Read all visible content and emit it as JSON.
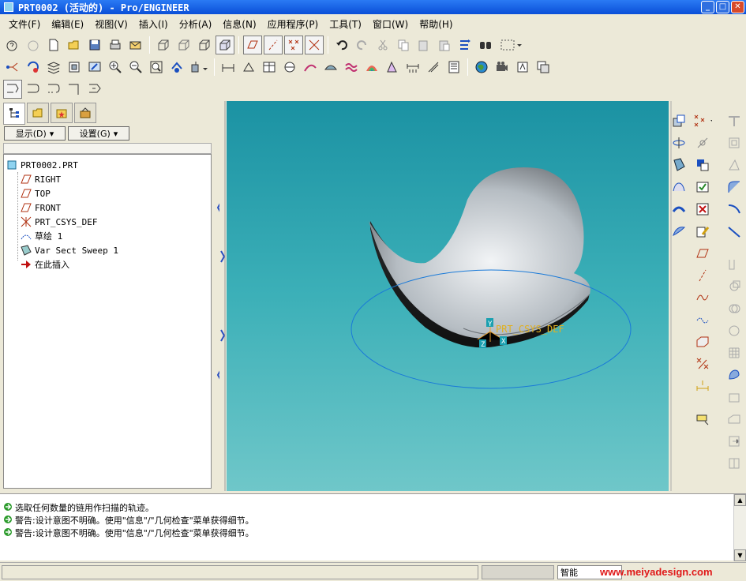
{
  "window": {
    "title": "PRT0002 (活动的) - Pro/ENGINEER"
  },
  "menu": [
    "文件(F)",
    "编辑(E)",
    "视图(V)",
    "插入(I)",
    "分析(A)",
    "信息(N)",
    "应用程序(P)",
    "工具(T)",
    "窗口(W)",
    "帮助(H)"
  ],
  "panel": {
    "display_btn": "显示(D)",
    "settings_btn": "设置(G)",
    "tree": [
      {
        "label": "PRT0002.PRT",
        "icon": "part-icon"
      },
      {
        "label": "RIGHT",
        "icon": "datum-plane-icon"
      },
      {
        "label": "TOP",
        "icon": "datum-plane-icon"
      },
      {
        "label": "FRONT",
        "icon": "datum-plane-icon"
      },
      {
        "label": "PRT_CSYS_DEF",
        "icon": "csys-icon"
      },
      {
        "label": "草绘 1",
        "icon": "sketch-icon"
      },
      {
        "label": "Var Sect Sweep 1",
        "icon": "sweep-icon"
      },
      {
        "label": "在此插入",
        "icon": "insert-arrow-icon"
      }
    ]
  },
  "viewport": {
    "csys_label": "PRT_CSYS_DEF",
    "axis_x": "X",
    "axis_y": "Y",
    "axis_z": "Z"
  },
  "messages": [
    "选取任何数量的链用作扫描的轨迹。",
    "警告:设计意图不明确。使用\"信息\"/\"几何检查\"菜单获得细节。",
    "警告:设计意图不明确。使用\"信息\"/\"几何检查\"菜单获得细节。"
  ],
  "status": {
    "filter": "智能",
    "watermark": "www.meiyadesign.com"
  },
  "colors": {
    "title": "#0a4fd8",
    "viewport_top": "#1b92a3",
    "viewport_bottom": "#6fc7c9",
    "watermark": "#e01818"
  }
}
